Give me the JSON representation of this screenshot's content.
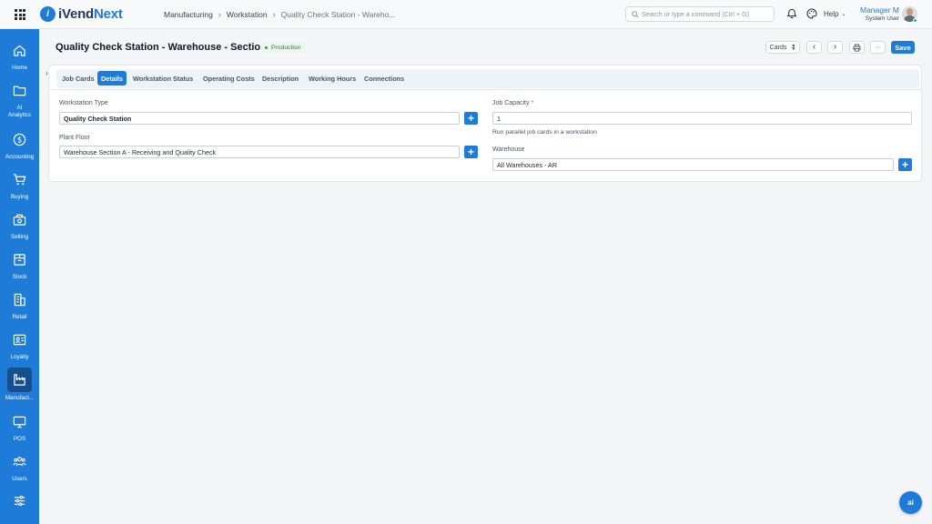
{
  "app": {
    "logo_text_1": "iVend",
    "logo_text_2": "Next",
    "logo_mark": "i"
  },
  "breadcrumb": [
    "Manufacturing",
    "Workstation",
    "Quality Check Station - Wareho..."
  ],
  "search": {
    "placeholder": "Search or type a command (Ctrl + G)"
  },
  "header_right": {
    "help_label": "Help",
    "user_name": "Manager M",
    "user_role": "System User"
  },
  "sidebar": {
    "items": [
      {
        "label": "Home",
        "icon": "home-icon"
      },
      {
        "label": "AI Analytics",
        "icon": "folder-icon"
      },
      {
        "label": "Accounting",
        "icon": "dollar-icon"
      },
      {
        "label": "Buying",
        "icon": "cart-icon"
      },
      {
        "label": "Selling",
        "icon": "register-icon"
      },
      {
        "label": "Stock",
        "icon": "box-icon"
      },
      {
        "label": "Retail",
        "icon": "store-icon"
      },
      {
        "label": "Loyalty",
        "icon": "id-card-icon"
      },
      {
        "label": "Manufact...",
        "icon": "factory-icon",
        "active": true
      },
      {
        "label": "POS",
        "icon": "monitor-icon"
      },
      {
        "label": "Users",
        "icon": "users-icon"
      },
      {
        "label": "",
        "icon": "sliders-icon"
      }
    ]
  },
  "page": {
    "title": "Quality Check Station - Warehouse - Section A",
    "status_badge": "Production",
    "view_select": "Cards",
    "save_label": "Save",
    "more_label": "···"
  },
  "tabs": [
    {
      "label": "Job Cards"
    },
    {
      "label": "Details",
      "active": true
    },
    {
      "label": "Workstation Status"
    },
    {
      "label": "Operating Costs"
    },
    {
      "label": "Description"
    },
    {
      "label": "Working Hours"
    },
    {
      "label": "Connections"
    }
  ],
  "form": {
    "workstation_type": {
      "label": "Workstation Type",
      "value": "Quality Check Station"
    },
    "plant_floor": {
      "label": "Plant Floor",
      "value": "Warehouse Section A - Receiving and Quality Check"
    },
    "job_capacity": {
      "label": "Job Capacity",
      "required_mark": "*",
      "value": "1",
      "help": "Run parallel job cards in a workstation"
    },
    "warehouse": {
      "label": "Warehouse",
      "value": "All Warehouses - AR"
    }
  },
  "fab": {
    "label": "ai"
  }
}
